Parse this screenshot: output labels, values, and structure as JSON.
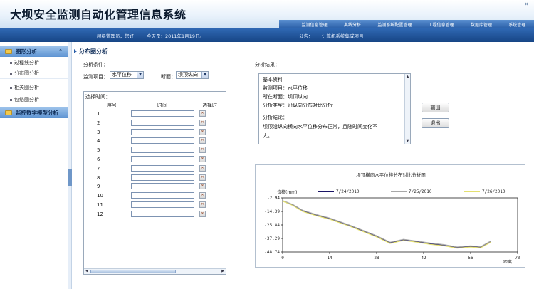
{
  "header": {
    "title": "大坝安全监测自动化管理信息系统",
    "nav": [
      "监测信息管理",
      "离线分析",
      "监测系统配置管理",
      "工程信息管理",
      "数据库管理",
      "系统管理"
    ]
  },
  "infobar": {
    "user": "超级管理员，您好！",
    "date": "今天是：2011年1月19日。",
    "notice_label": "公告：",
    "notice_text": "计算机系统集成项目"
  },
  "sidebar": {
    "section1": "图形分析",
    "items": [
      "过程线分析",
      "分布图分析",
      "相关图分析",
      "包络图分析"
    ],
    "section2": "监控数学模型分析"
  },
  "main": {
    "title": "分布图分析",
    "conditions_label": "分析条件：",
    "item_label": "监测项目：",
    "item_value": "水平位移",
    "section_label": "断面：",
    "section_value": "坝顶纵向",
    "time_label": "选择时间：",
    "col_no": "序号",
    "col_time": "时间",
    "col_select": "选择时",
    "rows": [
      "1",
      "2",
      "3",
      "4",
      "5",
      "6",
      "7",
      "8",
      "9",
      "10",
      "11",
      "12"
    ]
  },
  "results": {
    "label": "分析结果：",
    "lines": [
      "基本资料",
      "监测项目：水平位移",
      "所在断面：坝顶纵向",
      "分析类型：沿纵向分布对比分析",
      "分析结论：",
      "坝顶沿纵向横向水平位移分布正常，且随时间变化不",
      "大。"
    ],
    "export_button": "输出",
    "exit_button": "退出"
  },
  "chart_data": {
    "type": "line",
    "title": "坝顶横向水平位移分布对比分析图",
    "ylabel": "位移(mm)",
    "xlabel": "距离",
    "x_ticks": [
      0,
      14,
      28,
      42,
      56,
      70
    ],
    "y_ticks": [
      -2.94,
      -14.39,
      -25.84,
      -37.29,
      -48.74
    ],
    "xlim": [
      0,
      70
    ],
    "ylim": [
      -48.74,
      -2.94
    ],
    "x": [
      0,
      3,
      6,
      10,
      14,
      17,
      20,
      24,
      28,
      32,
      36,
      40,
      44,
      48,
      52,
      56,
      59,
      62
    ],
    "series": [
      {
        "name": "7/24/2010",
        "color": "#1a1466",
        "values": [
          -5.5,
          -9.0,
          -14.0,
          -17.5,
          -20.5,
          -23.5,
          -26.5,
          -31.0,
          -35.5,
          -41.0,
          -38.5,
          -40.0,
          -41.8,
          -43.0,
          -45.0,
          -44.0,
          -44.8,
          -40.0
        ]
      },
      {
        "name": "7/25/2010",
        "color": "#a8a8a8",
        "values": [
          -5.2,
          -8.5,
          -13.5,
          -17.0,
          -20.0,
          -23.0,
          -26.0,
          -30.5,
          -35.0,
          -40.5,
          -38.0,
          -39.5,
          -41.2,
          -42.5,
          -44.5,
          -43.5,
          -44.2,
          -39.5
        ]
      },
      {
        "name": "7/26/2010",
        "color": "#e4e070",
        "values": [
          -5.8,
          -9.3,
          -14.5,
          -18.0,
          -21.0,
          -24.0,
          -27.0,
          -31.5,
          -36.0,
          -41.5,
          -39.0,
          -40.5,
          -42.3,
          -43.5,
          -45.5,
          -44.5,
          -45.2,
          -40.5
        ]
      }
    ],
    "grid": false,
    "legend_position": "top"
  },
  "colors": {
    "accent": "#2a5fa8",
    "nav_bg": "#2f68b3",
    "sidebar_head": "#5d93d2"
  },
  "icons": {
    "close": "close-icon",
    "folder": "folder-icon",
    "collapse": "collapse-icon",
    "dropdown": "chevron-down-icon",
    "picker": "calendar-picker-icon"
  }
}
